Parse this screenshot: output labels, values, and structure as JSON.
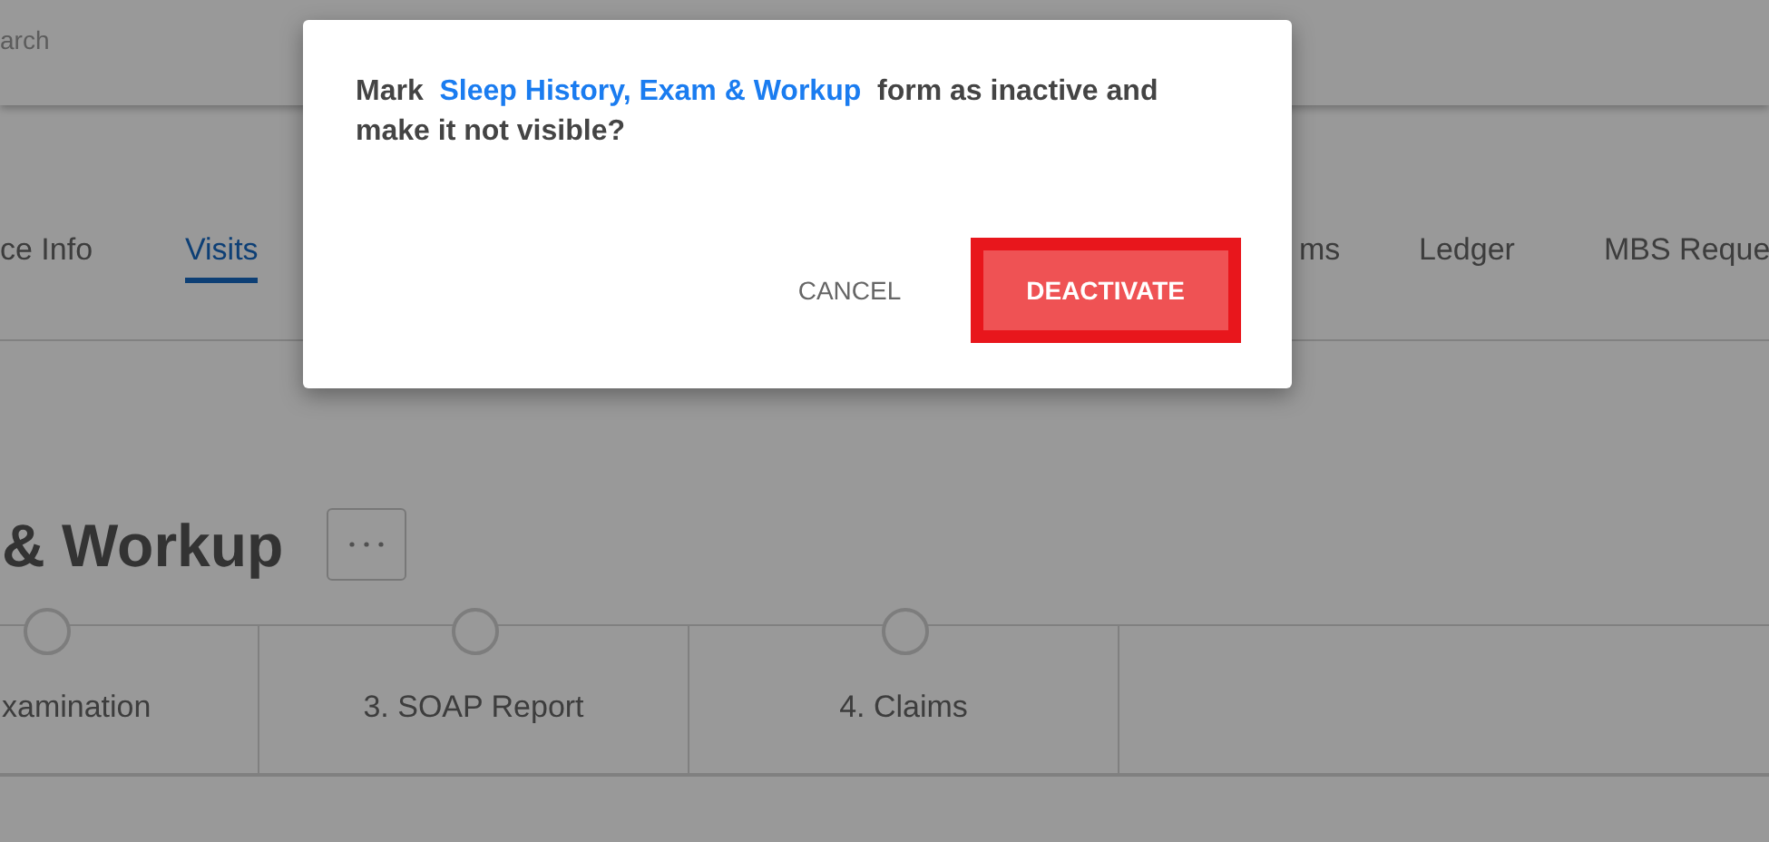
{
  "search": {
    "placeholder": "arch"
  },
  "tabs": [
    {
      "label": "ce Info",
      "selected": false
    },
    {
      "label": "Visits",
      "selected": true
    },
    {
      "label": "ms",
      "selected": false
    },
    {
      "label": "Ledger",
      "selected": false
    },
    {
      "label": "MBS Reque",
      "selected": false
    }
  ],
  "form_title": "& Workup",
  "steps": [
    {
      "label": "xamination"
    },
    {
      "label": "3. SOAP Report"
    },
    {
      "label": "4. Claims"
    }
  ],
  "dialog": {
    "message_before": "Mark",
    "form_name": "Sleep History, Exam & Workup",
    "message_after": "form as inactive and make it not visible?",
    "buttons": [
      {
        "label": "CANCEL",
        "kind": "text"
      },
      {
        "label": "DEACTIVATE",
        "kind": "danger"
      }
    ]
  }
}
